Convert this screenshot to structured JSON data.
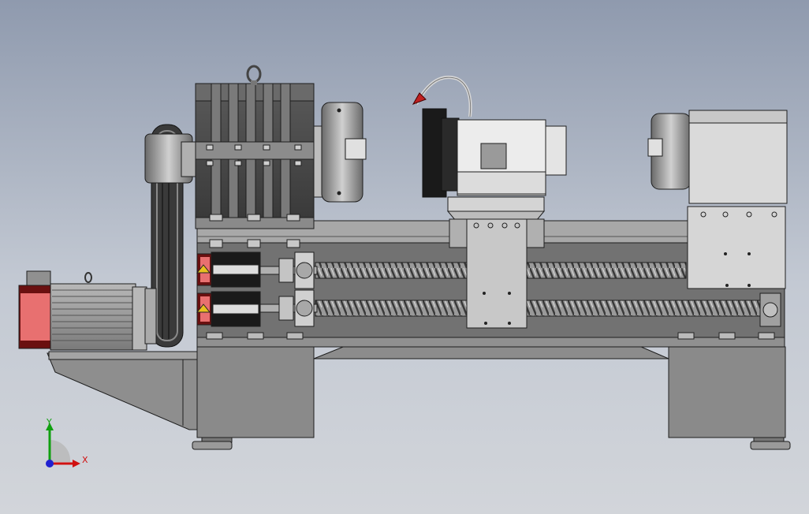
{
  "viewport": {
    "background_top": "#8f9aae",
    "background_bottom": "#d2d5da"
  },
  "model": {
    "machine": "lathe-assembly",
    "colors": {
      "steel_dark": "#4a4a4a",
      "steel_mid": "#8a8a8a",
      "steel_light": "#c8c8c8",
      "edge": "#1e1e1e",
      "motor_accent": "#e87070",
      "motor_accent_dark": "#6a1010",
      "warning": "#e8c020",
      "cable": "#d8d8d8",
      "cable_tip": "#c02020"
    }
  },
  "triad": {
    "x_label": "X",
    "y_label": "Y",
    "x_color": "#d01010",
    "y_color": "#10a010",
    "z_color": "#2020d0"
  }
}
